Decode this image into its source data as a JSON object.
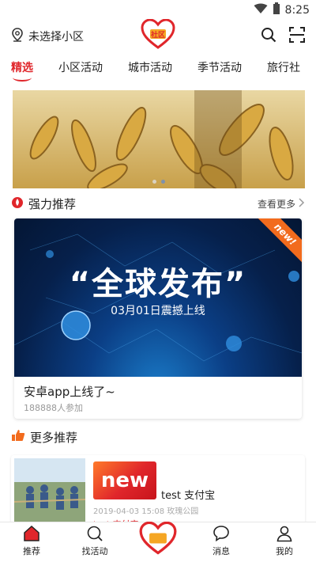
{
  "status": {
    "time": "8:25"
  },
  "header": {
    "location": "未选择小区",
    "logo_text": "社区"
  },
  "tabs": [
    {
      "label": "精选"
    },
    {
      "label": "小区活动"
    },
    {
      "label": "城市活动"
    },
    {
      "label": "季节活动"
    },
    {
      "label": "旅行社"
    }
  ],
  "featured": {
    "title": "强力推荐",
    "more": "查看更多"
  },
  "featured_card": {
    "ribbon": "new!",
    "headline": "“全球发布”",
    "subline": "03月01日震撼上线",
    "title": "安卓app上线了~",
    "participants": "188888人参加"
  },
  "more_section": {
    "title": "更多推荐"
  },
  "list": [
    {
      "image_text": "new",
      "name": "test 支付宝",
      "meta": "2019-04-03 15:08 玫瑰公园",
      "tag": "test 支付宝"
    }
  ],
  "bottom_nav": [
    {
      "label": "推荐"
    },
    {
      "label": "找活动"
    },
    {
      "label": ""
    },
    {
      "label": "消息"
    },
    {
      "label": "我的"
    }
  ],
  "colors": {
    "accent": "#e0262b"
  }
}
